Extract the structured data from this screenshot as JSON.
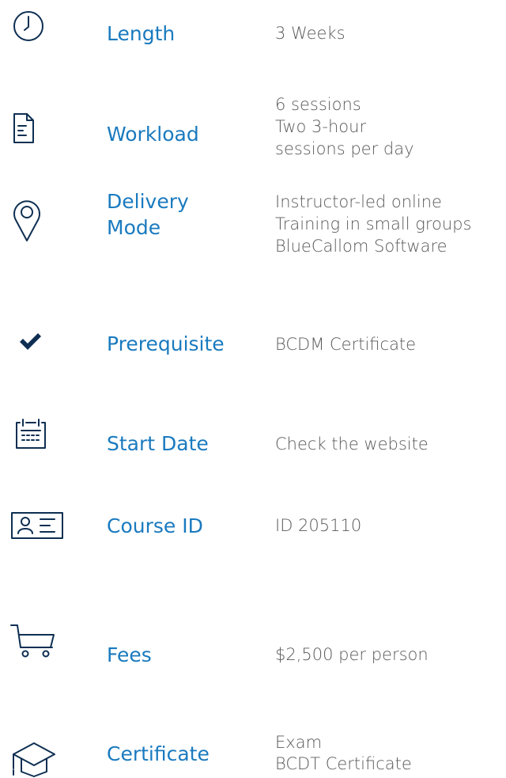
{
  "colors": {
    "label": "#1a7abf",
    "value": "#5a5a5a",
    "icon": "#0e2f52"
  },
  "rows": [
    {
      "icon": "clock-icon",
      "label": "Length",
      "values": [
        "3 Weeks"
      ]
    },
    {
      "icon": "document-icon",
      "label": "Workload",
      "values": [
        "6 sessions",
        "Two 3-hour",
        "sessions per day"
      ]
    },
    {
      "icon": "location-pin-icon",
      "label_lines": [
        "Delivery",
        "Mode"
      ],
      "values": [
        "Instructor-led online",
        "Training in small groups",
        "BlueCallom Software"
      ]
    },
    {
      "icon": "checkmark-icon",
      "label": "Prerequisite",
      "values": [
        "BCDM Certificate"
      ]
    },
    {
      "icon": "calendar-icon",
      "label": "Start Date",
      "values": [
        "Check the website"
      ]
    },
    {
      "icon": "id-card-icon",
      "label": "Course ID",
      "values": [
        "ID 205110"
      ]
    },
    {
      "icon": "shopping-cart-icon",
      "label": "Fees",
      "values": [
        "$2,500 per person"
      ]
    },
    {
      "icon": "graduation-cap-icon",
      "label": "Certificate",
      "values": [
        "Exam",
        "BCDT Certificate"
      ]
    }
  ]
}
